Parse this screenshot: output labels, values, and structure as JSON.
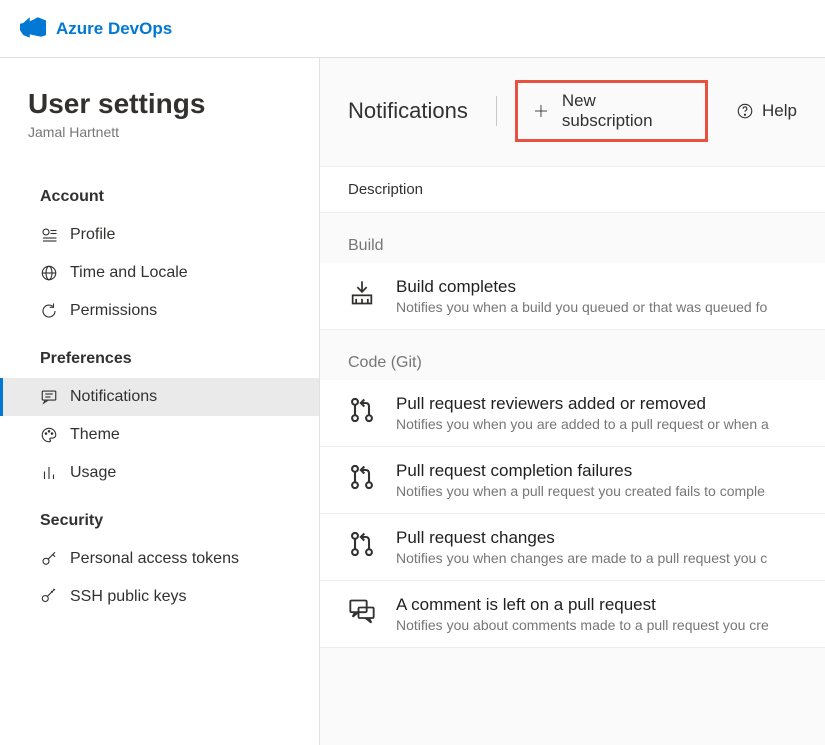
{
  "brand": "Azure DevOps",
  "pageTitle": "User settings",
  "userName": "Jamal Hartnett",
  "sections": {
    "account": {
      "head": "Account",
      "items": [
        {
          "label": "Profile"
        },
        {
          "label": "Time and Locale"
        },
        {
          "label": "Permissions"
        }
      ]
    },
    "preferences": {
      "head": "Preferences",
      "items": [
        {
          "label": "Notifications"
        },
        {
          "label": "Theme"
        },
        {
          "label": "Usage"
        }
      ]
    },
    "security": {
      "head": "Security",
      "items": [
        {
          "label": "Personal access tokens"
        },
        {
          "label": "SSH public keys"
        }
      ]
    }
  },
  "toolbar": {
    "title": "Notifications",
    "newSubscription": "New subscription",
    "help": "Help"
  },
  "descriptionHeader": "Description",
  "groups": {
    "build": {
      "label": "Build",
      "items": [
        {
          "title": "Build completes",
          "desc": "Notifies you when a build you queued or that was queued fo"
        }
      ]
    },
    "code": {
      "label": "Code (Git)",
      "items": [
        {
          "title": "Pull request reviewers added or removed",
          "desc": "Notifies you when you are added to a pull request or when a"
        },
        {
          "title": "Pull request completion failures",
          "desc": "Notifies you when a pull request you created fails to comple"
        },
        {
          "title": "Pull request changes",
          "desc": "Notifies you when changes are made to a pull request you c"
        },
        {
          "title": "A comment is left on a pull request",
          "desc": "Notifies you about comments made to a pull request you cre"
        }
      ]
    }
  }
}
